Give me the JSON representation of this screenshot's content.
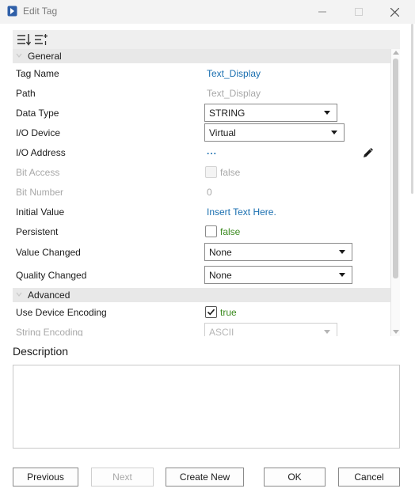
{
  "window": {
    "title": "Edit Tag"
  },
  "sections": {
    "general": "General",
    "advanced": "Advanced"
  },
  "rows": {
    "tag_name": {
      "label": "Tag Name",
      "value": "Text_Display"
    },
    "path": {
      "label": "Path",
      "value": "Text_Display"
    },
    "data_type": {
      "label": "Data Type",
      "value": "STRING"
    },
    "io_device": {
      "label": "I/O Device",
      "value": "Virtual"
    },
    "io_address": {
      "label": "I/O Address",
      "value": "..."
    },
    "bit_access": {
      "label": "Bit Access",
      "value": "false",
      "checked": false,
      "enabled": false
    },
    "bit_number": {
      "label": "Bit Number",
      "value": "0"
    },
    "initial_value": {
      "label": "Initial Value",
      "value": "Insert Text Here."
    },
    "persistent": {
      "label": "Persistent",
      "value": "false",
      "checked": false
    },
    "value_changed": {
      "label": "Value Changed",
      "value": "None"
    },
    "quality_changed": {
      "label": "Quality Changed",
      "value": "None"
    },
    "use_device_encoding": {
      "label": "Use Device Encoding",
      "value": "true",
      "checked": true
    },
    "string_encoding": {
      "label": "String Encoding",
      "value": "ASCII",
      "enabled": false
    }
  },
  "description": {
    "label": "Description",
    "value": ""
  },
  "buttons": {
    "previous": "Previous",
    "next": "Next",
    "create_new": "Create New",
    "ok": "OK",
    "cancel": "Cancel"
  },
  "colors": {
    "link": "#1a6fb0",
    "bool_value": "#3b8a1f",
    "disabled": "#a8a8a8",
    "section_bg": "#e8e8e8"
  },
  "icons": [
    "app-icon",
    "minimize-icon",
    "maximize-icon",
    "close-icon",
    "sort-icon",
    "categorize-icon",
    "chevron-down-icon",
    "pencil-icon",
    "checkmark-icon",
    "dropdown-arrow-icon"
  ]
}
